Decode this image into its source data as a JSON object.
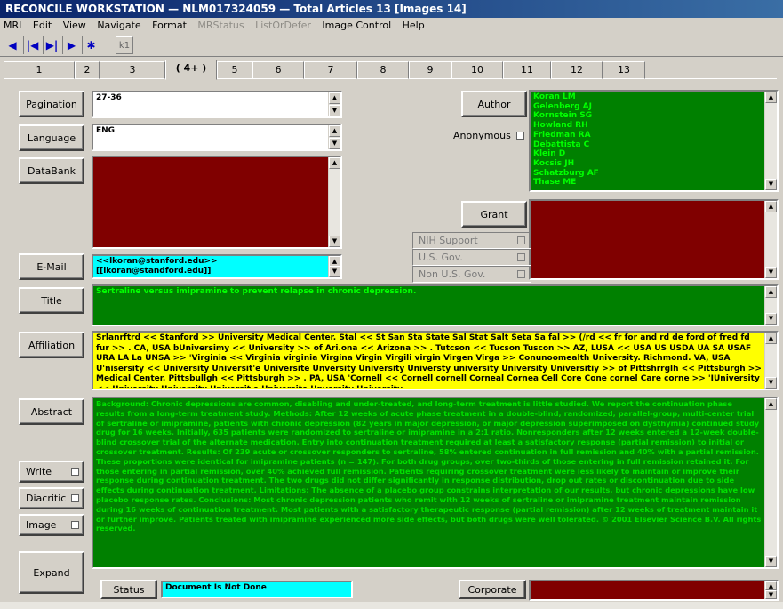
{
  "window": {
    "title": "RECONCILE WORKSTATION  —  NLM017324059  —  Total Articles 13  [Images 14]"
  },
  "menu": {
    "items": [
      "MRI",
      "Edit",
      "View",
      "Navigate",
      "Format",
      "MRStatus",
      "ListOrDefer",
      "Image Control",
      "Help"
    ],
    "disabled": [
      "MRStatus",
      "ListOrDefer"
    ]
  },
  "toolbar": {
    "first": "◀",
    "prev": "|◀",
    "next": "▶|",
    "last": "▶",
    "star": "✱",
    "k1": "k1"
  },
  "tabs": [
    "1",
    "2",
    "3",
    "( 4+ )",
    "5",
    "6",
    "7",
    "8",
    "9",
    "10",
    "11",
    "12",
    "13"
  ],
  "active_tab": "( 4+ )",
  "buttons": {
    "pagination": "Pagination",
    "language": "Language",
    "databank": "DataBank",
    "email": "E-Mail",
    "title": "Title",
    "affiliation": "Affiliation",
    "abstract": "Abstract",
    "expand": "Expand",
    "status": "Status",
    "author": "Author",
    "grant": "Grant",
    "corporate": "Corporate"
  },
  "checkboxes": {
    "anonymous": "Anonymous",
    "write": "Write",
    "diacritic": "Diacritic",
    "image": "Image"
  },
  "grant_options": [
    "NIH Support",
    "U.S. Gov.",
    "Non U.S. Gov."
  ],
  "fields": {
    "pagination": "27-36",
    "language": "ENG",
    "databank": "",
    "email": "<<lkoran@stanford.edu>>[[lkoran@standford.edu]]",
    "title": "Sertraline versus imipramine to prevent relapse in chronic depression.",
    "affiliation": "Srlanrftrd << Stanford >> University Medical Center. Stal << St San Sta State Sal Stat Salt Seta Sa fal >> (/rd << fr for and rd de ford of fred fd fur >> . CA, USA bUniversimy << University >> of Ari.ona << Arizona >> . Tutcson << Tucson Tuscon >> AZ, LUSA << USA US USDA UA SA USAF URA LA La UNSA >> 'Virginia << Virginia virginia Virgina Virgin Virgili virgin Virgen Virga >> Conunoomealth University. Richmond. VA, USA U'nisersity << University Universit'e Universite Unversity University Universty university University Universitiy >> of Pittshrrglh << Pittsburgh >> Medical Center. Pittsbullgh << Pittsburgh >> . PA, USA 'Cornell << Cornell cornell Corneal Cornea Cell Core Cone cornel Care corne >> 'IUniversity << University University Universit'e Universite Unversity University",
    "abstract": "Background: Chronic depressions are common, disabling and under-treated, and long-term treatment is little studied. We report the continuation phase results from a long-term treatment study. Methods: After 12 weeks of acute phase treatment in a double-blind, randomized, parallel-group, multi-center trial of sertraline or imipramine, patients with chronic depression (82 years in major depression, or major depression superimposed on dysthymia) continued study drug for 16 weeks. Initially, 635 patients were randomized to sertraline or imipramine in a 2:1 ratio. Nonresponders after 12 weeks entered a 12-week double-blind crossover trial of the alternate medication. Entry into continuation treatment required at least a satisfactory response (partial remission) to initial or crossover treatment. Results: Of 239 acute or crossover responders to sertraline, 58% entered continuation in full remission and 40% with a partial remission. These proportions were identical for imipramine patients (n = 147). For both drug groups, over two-thirds of those entering in full remission retained it. For those entering in partial remission, over 40% achieved full remission. Patients requiring crossover treatment were less likely to maintain or improve their response during continuation treatment. The two drugs did not differ significantly in response distribution, drop out rates or discontinuation due to side effects during continuation treatment. Limitations: The absence of a placebo group constrains interpretation of our results, but chronic depressions have low placebo response rates. Conclusions: Most chronic depression patients who remit with 12 weeks of sertraline or imipramine treatment maintain remission during 16 weeks of continuation treatment. Most patients with a satisfactory therapeutic response (partial remission) after 12 weeks of treatment maintain it or further improve. Patients treated with imipramine experienced more side effects, but both drugs were well tolerated. © 2001 Elsevier Science B.V. All rights reserved.",
    "status": "Document Is Not Done",
    "grant": "",
    "corporate": ""
  },
  "authors": [
    "Koran LM",
    "Gelenberg AJ",
    "Kornstein SG",
    "Howland RH",
    "Friedman RA",
    "Debattista C",
    "Klein D",
    "Kocsis JH",
    "Schatzburg AF",
    "Thase ME"
  ],
  "colors": {
    "green_field": "#008000",
    "green_text": "#00ff00",
    "maroon_field": "#800000",
    "cyan_field": "#00ffff",
    "yellow_field": "#ffff00",
    "title_bar": "#0a246a"
  }
}
